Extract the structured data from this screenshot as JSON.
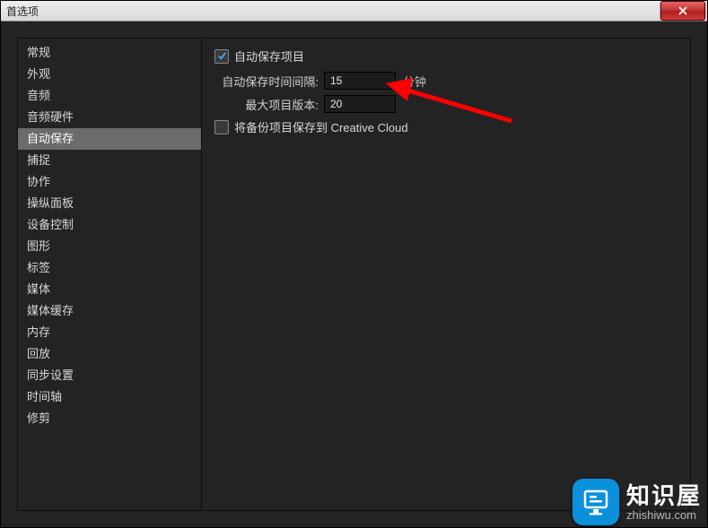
{
  "window": {
    "title": "首选项"
  },
  "sidebar": {
    "items": [
      "常规",
      "外观",
      "音频",
      "音频硬件",
      "自动保存",
      "捕捉",
      "协作",
      "操纵面板",
      "设备控制",
      "图形",
      "标签",
      "媒体",
      "媒体缓存",
      "内存",
      "回放",
      "同步设置",
      "时间轴",
      "修剪"
    ],
    "selected_index": 4
  },
  "content": {
    "auto_save_checkbox_label": "自动保存项目",
    "auto_save_checked": true,
    "interval_label": "自动保存时间间隔:",
    "interval_value": "15",
    "interval_unit": "分钟",
    "max_versions_label": "最大项目版本:",
    "max_versions_value": "20",
    "backup_cc_label": "将备份项目保存到 Creative Cloud",
    "backup_cc_checked": false
  },
  "watermark": {
    "cn": "知识屋",
    "en": "zhishiwu.com"
  }
}
